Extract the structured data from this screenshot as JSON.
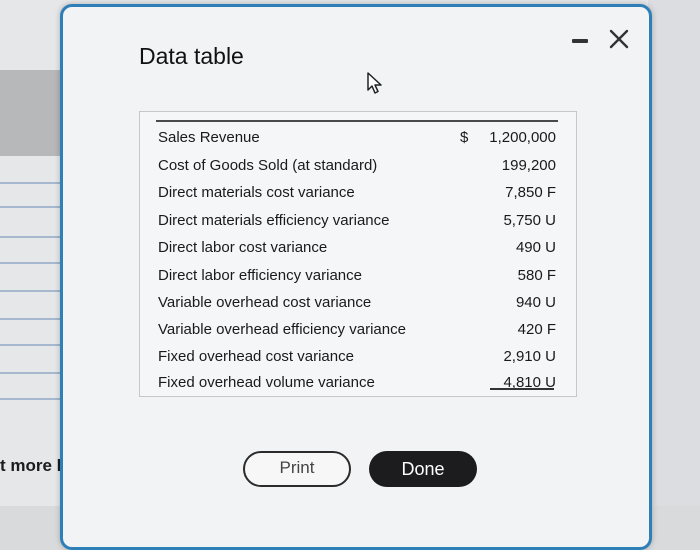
{
  "background": {
    "more_help_text": "t more hel"
  },
  "modal": {
    "title": "Data table",
    "icons": {
      "minimize": "minimize-icon",
      "close": "close-icon",
      "cursor": "pointer-cursor-icon"
    }
  },
  "table": {
    "currency_symbol": "$",
    "rows": [
      {
        "label": "Sales Revenue",
        "value": "1,200,000"
      },
      {
        "label": "Cost of Goods Sold (at standard)",
        "value": "199,200"
      },
      {
        "label": "Direct materials cost variance",
        "value": "7,850 F"
      },
      {
        "label": "Direct materials efficiency variance",
        "value": "5,750 U"
      },
      {
        "label": "Direct labor cost variance",
        "value": "490 U"
      },
      {
        "label": "Direct labor efficiency variance",
        "value": "580 F"
      },
      {
        "label": "Variable overhead cost variance",
        "value": "940 U"
      },
      {
        "label": "Variable overhead efficiency variance",
        "value": "420 F"
      },
      {
        "label": "Fixed overhead cost variance",
        "value": "2,910 U"
      },
      {
        "label": "Fixed overhead volume variance",
        "value": "4,810 U"
      }
    ]
  },
  "buttons": {
    "print": "Print",
    "done": "Done"
  },
  "colors": {
    "modal_border": "#2e7fb8",
    "done_button": "#1c1c1e"
  }
}
